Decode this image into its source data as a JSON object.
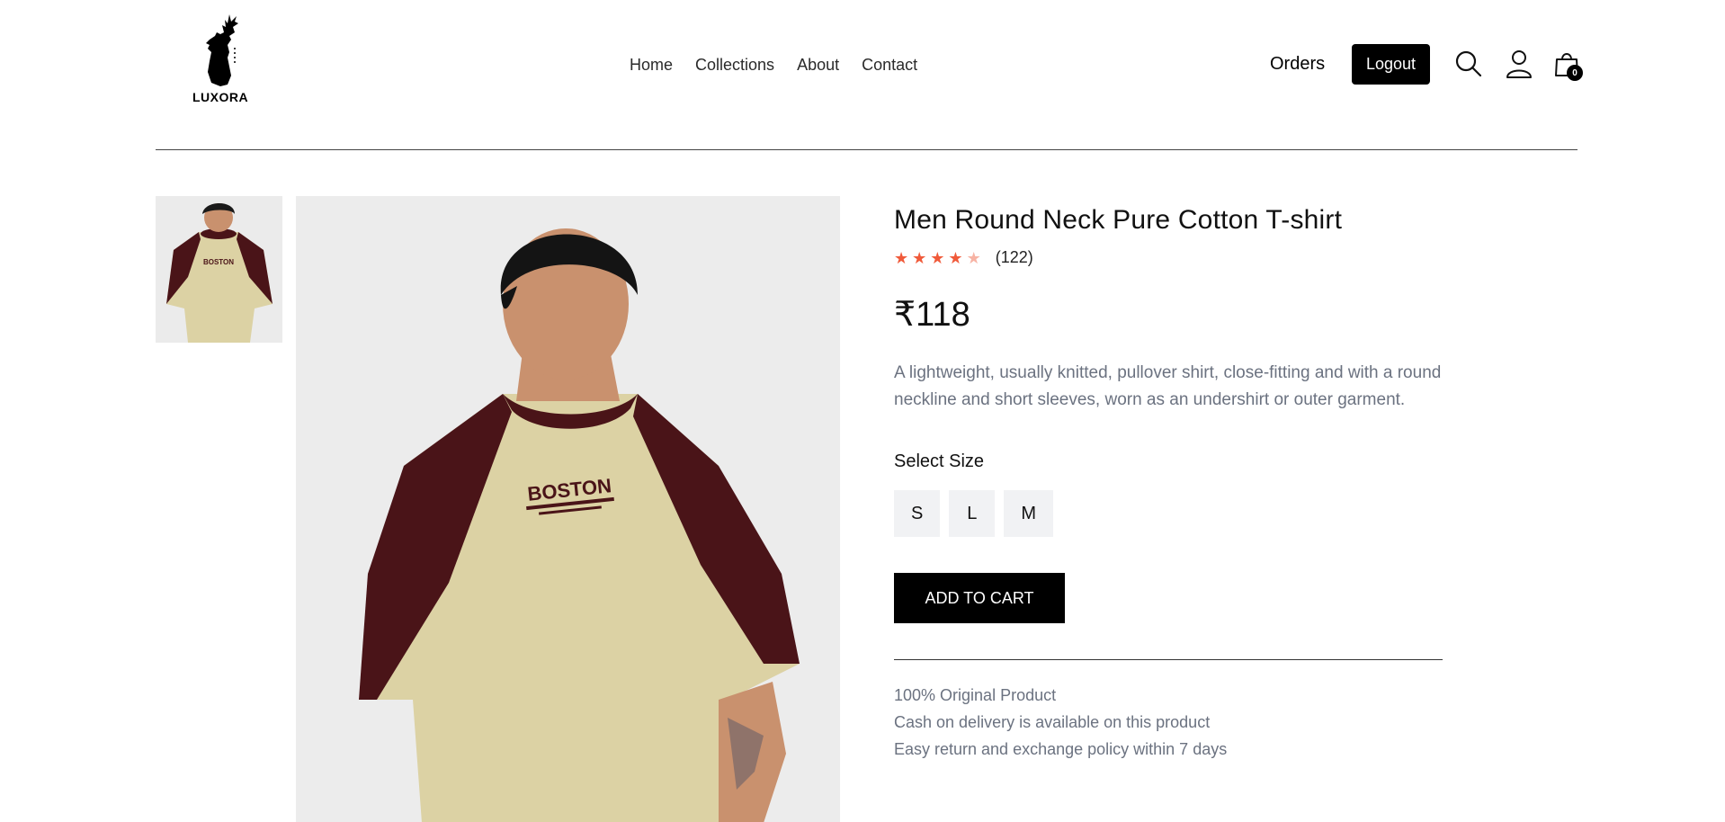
{
  "brand": {
    "name": "LUXORA"
  },
  "nav": {
    "items": [
      "Home",
      "Collections",
      "About",
      "Contact"
    ]
  },
  "header": {
    "orders_label": "Orders",
    "logout_label": "Logout",
    "cart_count": "0"
  },
  "product": {
    "title": "Men Round Neck Pure Cotton T-shirt",
    "rating": 4,
    "rating_max": 5,
    "review_count": "(122)",
    "price": "₹118",
    "description": "A lightweight, usually knitted, pullover shirt, close-fitting and with a round neckline and short sleeves, worn as an undershirt or outer garment.",
    "size_label": "Select Size",
    "sizes": [
      "S",
      "L",
      "M"
    ],
    "add_to_cart_label": "ADD TO CART",
    "image_print_text": "BOSTON",
    "notes": [
      "100% Original Product",
      "Cash on delivery is available on this product",
      "Easy return and exchange policy within 7 days"
    ]
  },
  "colors": {
    "accent": "#000000",
    "star_on": "#f05a3a",
    "star_off": "#f7b3a4",
    "muted_text": "#6b7280",
    "shirt_body": "#dcd2a4",
    "shirt_sleeve": "#4a1418"
  },
  "icons": [
    "search-icon",
    "user-icon",
    "shopping-bag-icon",
    "star-icon",
    "deer-logo-icon"
  ]
}
